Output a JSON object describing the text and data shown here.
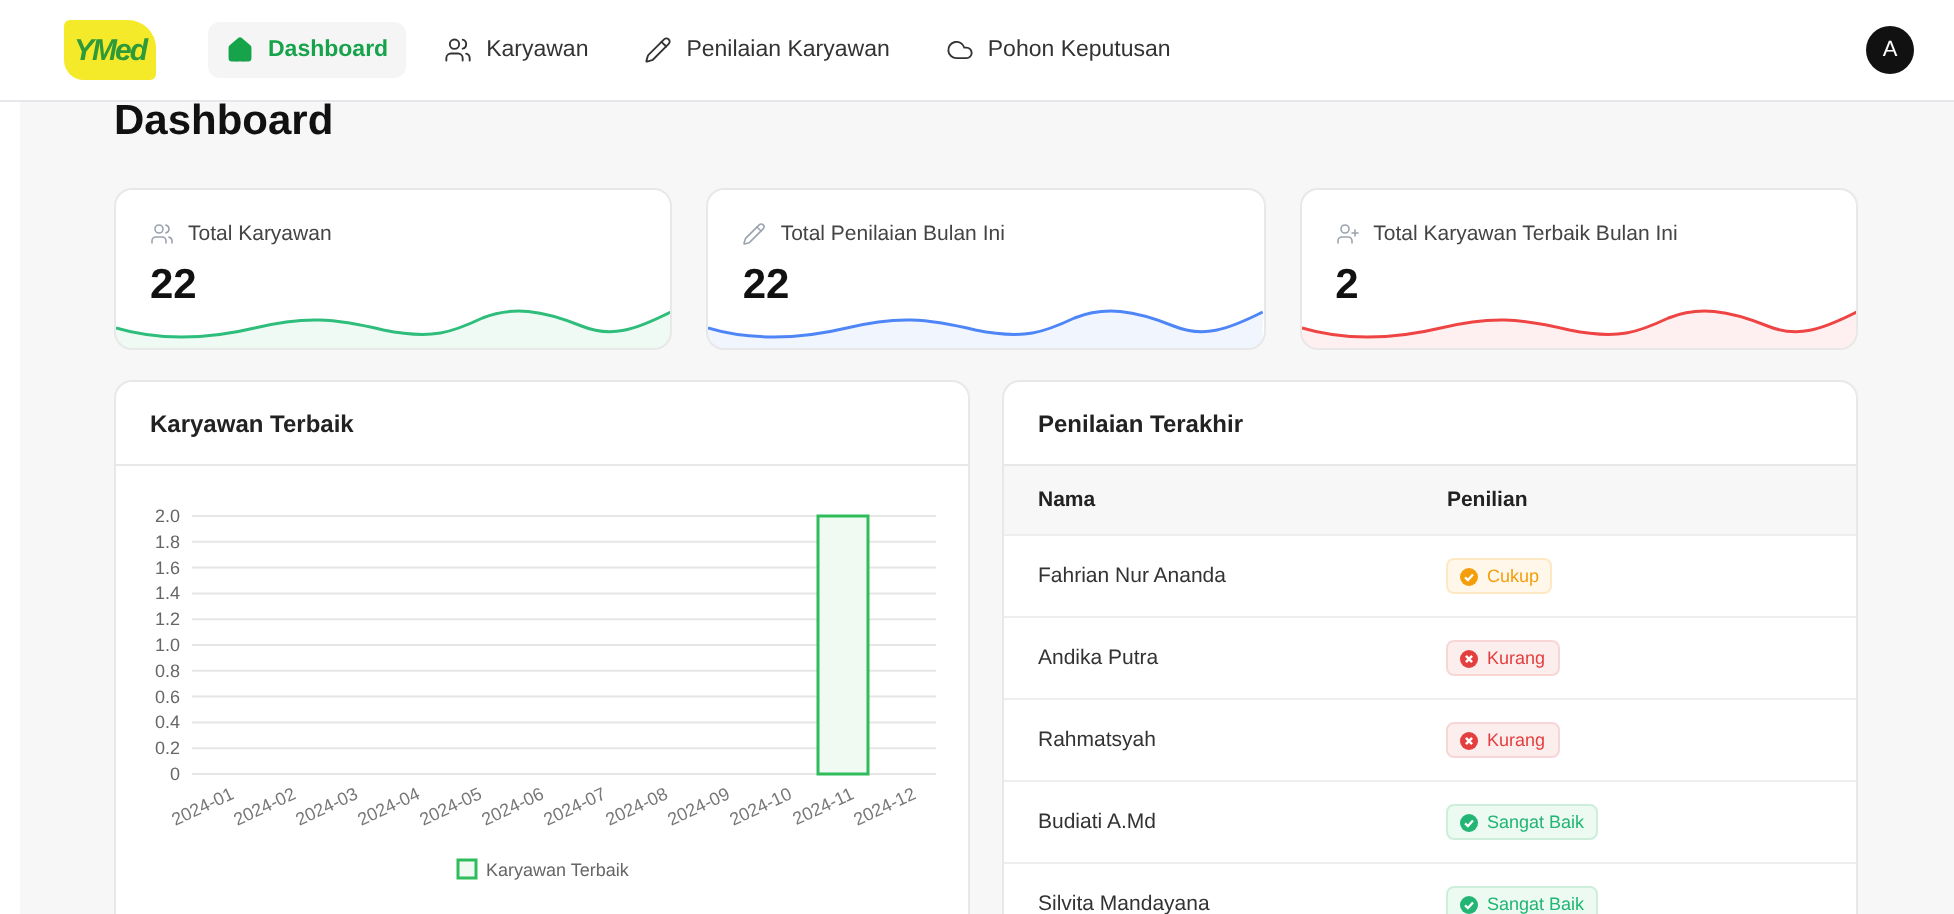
{
  "logo": "YMed",
  "nav": [
    {
      "label": "Dashboard",
      "kind": "home",
      "selected": true
    },
    {
      "label": "Karyawan",
      "kind": "users",
      "selected": false
    },
    {
      "label": "Penilaian Karyawan",
      "kind": "pencil",
      "selected": false
    },
    {
      "label": "Pohon Keputusan",
      "kind": "cloud",
      "selected": false
    }
  ],
  "avatar": "A",
  "page_title": "Dashboard",
  "stats": [
    {
      "label": "Total Karyawan",
      "value": "22",
      "kind": "users",
      "color": "#2ebd7a"
    },
    {
      "label": "Total Penilaian Bulan Ini",
      "value": "22",
      "kind": "pencil",
      "color": "#4f86f7"
    },
    {
      "label": "Total Karyawan Terbaik Bulan Ini",
      "value": "2",
      "kind": "user-plus",
      "color": "#ef4444"
    }
  ],
  "best_panel": {
    "title": "Karyawan Terbaik",
    "chart_data": {
      "type": "bar",
      "categories": [
        "2024-01",
        "2024-02",
        "2024-03",
        "2024-04",
        "2024-05",
        "2024-06",
        "2024-07",
        "2024-08",
        "2024-09",
        "2024-10",
        "2024-11",
        "2024-12"
      ],
      "series": [
        {
          "name": "Karyawan Terbaik",
          "color": "#2ebd5a",
          "values": [
            0,
            0,
            0,
            0,
            0,
            0,
            0,
            0,
            0,
            0,
            2,
            0
          ]
        }
      ],
      "grid": true,
      "ylim": [
        0,
        2
      ],
      "yticks": [
        0,
        {
          "value": 0.2,
          "label": "0.2"
        },
        {
          "value": 0.4,
          "label": "0.4"
        },
        {
          "value": 0.6,
          "label": "0.6"
        },
        {
          "value": 0.8,
          "label": "0.8"
        },
        {
          "value": 1,
          "label": "1.0"
        },
        {
          "value": 1.2,
          "label": "1.2"
        },
        {
          "value": 1.4,
          "label": "1.4"
        },
        {
          "value": 1.6,
          "label": "1.6"
        },
        {
          "value": 1.8,
          "label": "1.8"
        },
        {
          "value": 2,
          "label": "2.0"
        }
      ]
    }
  },
  "recent_panel": {
    "title": "Penilaian Terakhir",
    "columns": [
      "Nama",
      "Penilian"
    ],
    "rows": [
      {
        "name": "Fahrian Nur Ananda",
        "rating": "Cukup",
        "kind": "fair"
      },
      {
        "name": "Andika Putra",
        "rating": "Kurang",
        "kind": "poor"
      },
      {
        "name": "Rahmatsyah",
        "rating": "Kurang",
        "kind": "poor"
      },
      {
        "name": "Budiati A.Md",
        "rating": "Sangat Baik",
        "kind": "excellent"
      },
      {
        "name": "Silvita Mandayana",
        "rating": "Sangat Baik",
        "kind": "excellent"
      }
    ]
  }
}
